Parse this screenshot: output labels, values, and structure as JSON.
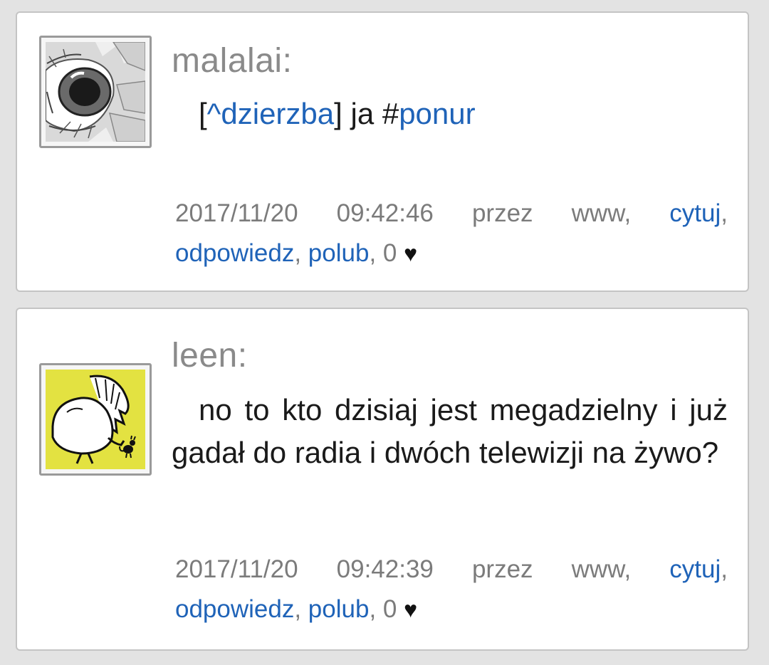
{
  "posts": [
    {
      "author": "malalai:",
      "content": {
        "bracket_open": "[",
        "mention": "^dzierzba",
        "bracket_close": "]",
        "text": " ja #",
        "hashtag": "ponur"
      },
      "meta": {
        "date": "2017/11/20",
        "time": "09:42:46",
        "via": "przez",
        "source": "www,",
        "quote": "cytuj",
        "reply": "odpowiedz",
        "like": "polub",
        "like_count": "0",
        "heart": "♥"
      }
    },
    {
      "author": "leen:",
      "content": {
        "text": "no to kto dzisiaj jest megadzielny i już gadał do radia i dwóch telewizji na żywo?"
      },
      "meta": {
        "date": "2017/11/20",
        "time": "09:42:39",
        "via": "przez",
        "source": "www,",
        "quote": "cytuj",
        "reply": "odpowiedz",
        "like": "polub",
        "like_count": "0",
        "heart": "♥"
      }
    }
  ],
  "colors": {
    "background": "#e3e3e3",
    "card": "#ffffff",
    "link": "#1f63b8",
    "author": "#8a8a8a",
    "meta": "#7b7b7b"
  }
}
